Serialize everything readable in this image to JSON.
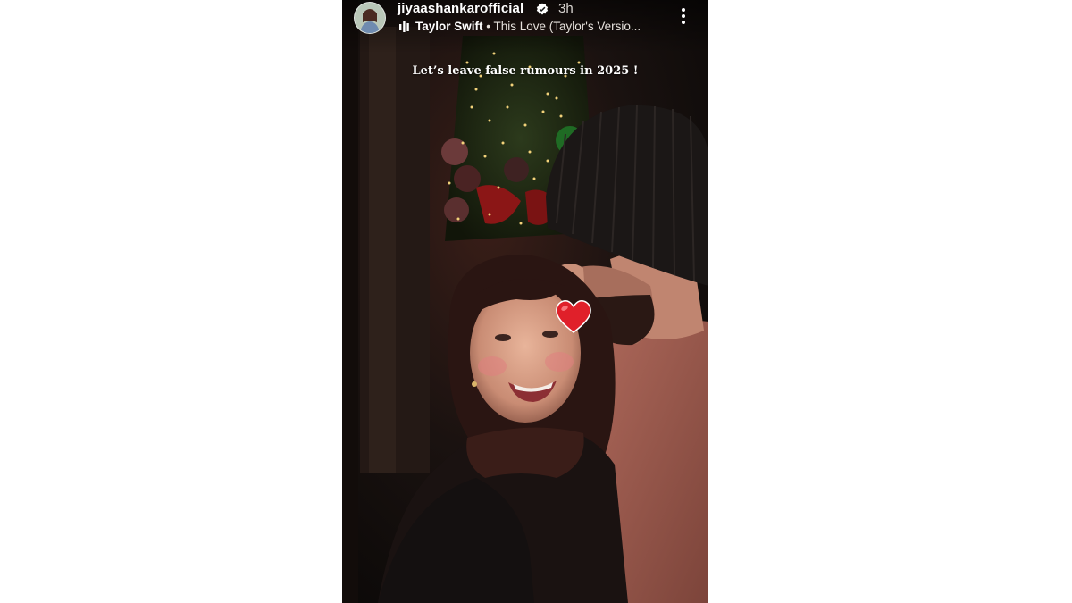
{
  "story": {
    "username": "jiyaashankarofficial",
    "time": "3h",
    "music": {
      "artist": "Taylor Swift",
      "separator": " • ",
      "track": "This Love (Taylor's Versio..."
    },
    "caption": "Let’s leave false rumours in 2025 !",
    "icons": {
      "verified": "verified-badge-icon",
      "music": "audio-bars-icon",
      "more": "more-vertical-icon",
      "sticker": "red-heart-emoji"
    },
    "colors": {
      "heart": "#e0202a",
      "verified": "#ffffff",
      "text": "#ffffff"
    }
  }
}
